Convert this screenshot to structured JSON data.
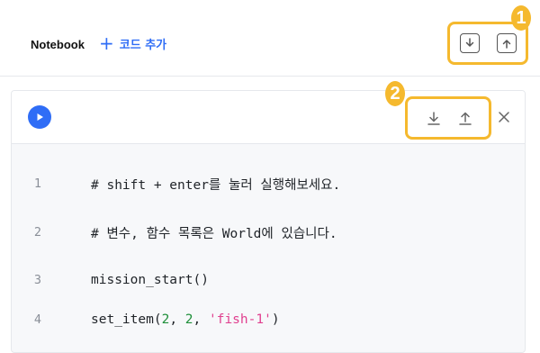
{
  "header": {
    "title": "Notebook",
    "add_code_plus": "+",
    "add_code_label": "코드 추가",
    "badge_1": "1"
  },
  "cell": {
    "badge_2": "2",
    "lines": [
      {
        "num": "1",
        "text": "# shift + enter를 눌러 실행해보세요."
      },
      {
        "num": "2",
        "text": "# 변수, 함수 목록은 World에 있습니다."
      },
      {
        "num": "3",
        "text": "mission_start()"
      },
      {
        "num": "4",
        "fn": "set_item(",
        "a1": "2",
        "sep1": ", ",
        "a2": "2",
        "sep2": ", ",
        "a3": "'fish-1'",
        "end": ")"
      }
    ]
  },
  "colors": {
    "accent": "#2f6df6",
    "highlight": "#f5b92e",
    "number": "#1f8f3a",
    "string": "#e0408f"
  },
  "icons": [
    "plus-icon",
    "download-icon",
    "upload-icon",
    "play-icon",
    "close-icon"
  ]
}
